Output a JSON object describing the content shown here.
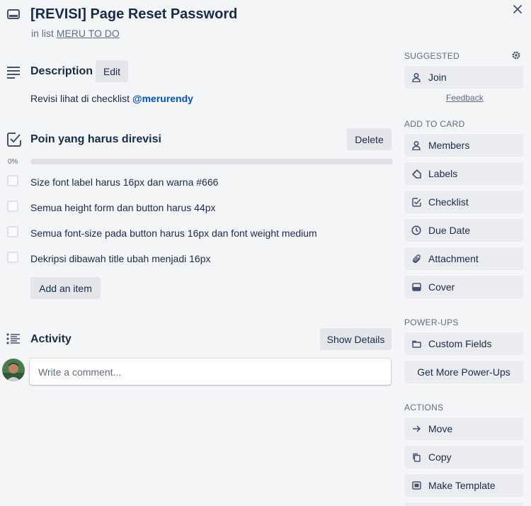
{
  "card": {
    "title": "[REVISI] Page Reset Password",
    "in_list_prefix": "in list",
    "list_name": "MERU TO DO"
  },
  "description": {
    "heading": "Description",
    "edit_label": "Edit",
    "text": "Revisi lihat di checklist ",
    "mention": "@merurendy"
  },
  "checklist": {
    "heading": "Poin yang harus direvisi",
    "delete_label": "Delete",
    "progress_label": "0%",
    "progress": 0,
    "items": [
      "Size font label harus 16px dan warna #666",
      "Semua height form dan button harus 44px",
      "Semua font-size pada button harus 16px dan font weight medium",
      "Dekripsi dibawah title ubah menjadi 16px"
    ],
    "add_item_label": "Add an item"
  },
  "activity": {
    "heading": "Activity",
    "show_details_label": "Show Details",
    "comment_placeholder": "Write a comment..."
  },
  "sidebar": {
    "suggested_heading": "SUGGESTED",
    "join_label": "Join",
    "feedback_label": "Feedback",
    "add_to_card_heading": "ADD TO CARD",
    "add_to_card": [
      {
        "label": "Members",
        "icon": "person-icon"
      },
      {
        "label": "Labels",
        "icon": "tag-icon"
      },
      {
        "label": "Checklist",
        "icon": "checkbox-icon"
      },
      {
        "label": "Due Date",
        "icon": "clock-icon"
      },
      {
        "label": "Attachment",
        "icon": "paperclip-icon"
      },
      {
        "label": "Cover",
        "icon": "cover-icon"
      }
    ],
    "powerups_heading": "POWER-UPS",
    "custom_fields_label": "Custom Fields",
    "get_more_label": "Get More Power-Ups",
    "actions_heading": "ACTIONS",
    "actions": [
      {
        "label": "Move",
        "icon": "arrow-right-icon"
      },
      {
        "label": "Copy",
        "icon": "copy-icon"
      },
      {
        "label": "Make Template",
        "icon": "template-icon"
      }
    ]
  },
  "colors": {
    "background": "#f4f5f7",
    "text": "#172b4d",
    "muted": "#5e6c84",
    "mention": "#0052cc"
  }
}
